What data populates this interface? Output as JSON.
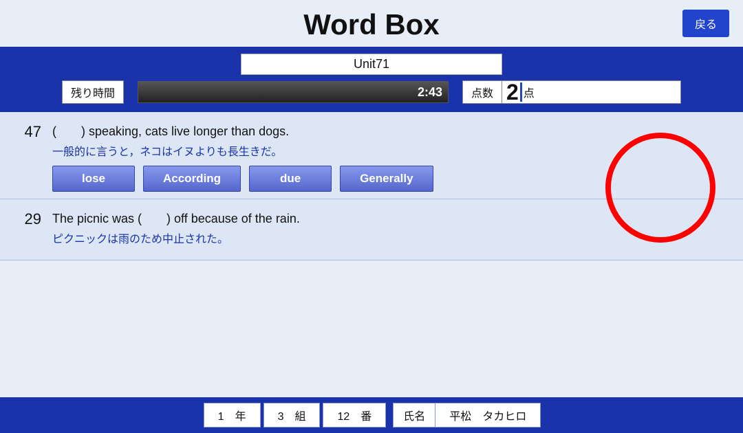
{
  "header": {
    "title": "Word Box",
    "back_button": "戻る"
  },
  "unit": {
    "label": "Unit71"
  },
  "timer": {
    "label": "残り時間",
    "value": "2:43"
  },
  "score": {
    "label": "点数",
    "value": "2",
    "unit": "点"
  },
  "questions": [
    {
      "number": "47",
      "text": "(　　) speaking, cats live longer than dogs.",
      "japanese": "一般的に言うと，ネコはイヌよりも長生きだ。",
      "answers": [
        "lose",
        "According",
        "due",
        "Generally"
      ]
    },
    {
      "number": "29",
      "text": "The picnic was (　　) off because of the rain.",
      "japanese": "ピクニックは雨のため中止された。",
      "answers": []
    }
  ],
  "footer": {
    "year_label": "1　年",
    "class_label": "3　組",
    "number_label": "12　番",
    "name_label": "氏名",
    "name_value": "平松　タカヒロ"
  }
}
